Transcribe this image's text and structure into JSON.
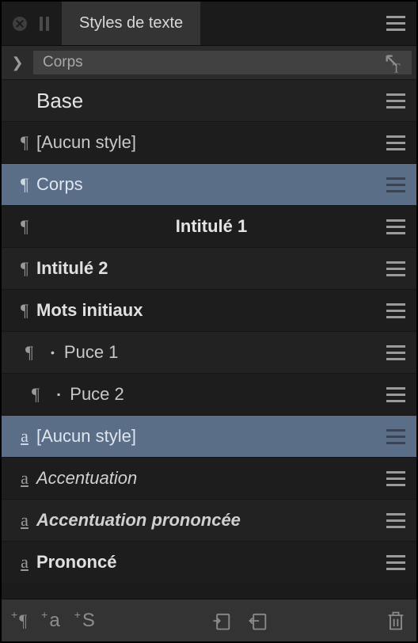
{
  "header": {
    "tab_label": "Styles de texte"
  },
  "breadcrumb": {
    "current": "Corps"
  },
  "rows": [
    {
      "kind": "base",
      "label": "Base"
    },
    {
      "kind": "para",
      "label": "[Aucun style]"
    },
    {
      "kind": "para",
      "label": "Corps",
      "selected": true
    },
    {
      "kind": "para",
      "label": "Intitulé 1",
      "variant": "h1"
    },
    {
      "kind": "para",
      "label": "Intitulé 2",
      "variant": "bold"
    },
    {
      "kind": "para",
      "label": "Mots initiaux",
      "variant": "bold"
    },
    {
      "kind": "para",
      "label": "Puce 1",
      "indent": 2,
      "bullet": "dot"
    },
    {
      "kind": "para",
      "label": "Puce 2",
      "indent": 3,
      "bullet": "square"
    },
    {
      "kind": "char",
      "label": "[Aucun style]",
      "selected": true
    },
    {
      "kind": "char",
      "label": "Accentuation",
      "variant": "italic"
    },
    {
      "kind": "char",
      "label": "Accentuation prononcée",
      "variant": "bolditalic"
    },
    {
      "kind": "char",
      "label": "Prononcé",
      "variant": "bold"
    }
  ],
  "footer": {
    "add_para_glyph": "¶",
    "add_char_glyph": "a",
    "add_style_glyph": "S"
  }
}
